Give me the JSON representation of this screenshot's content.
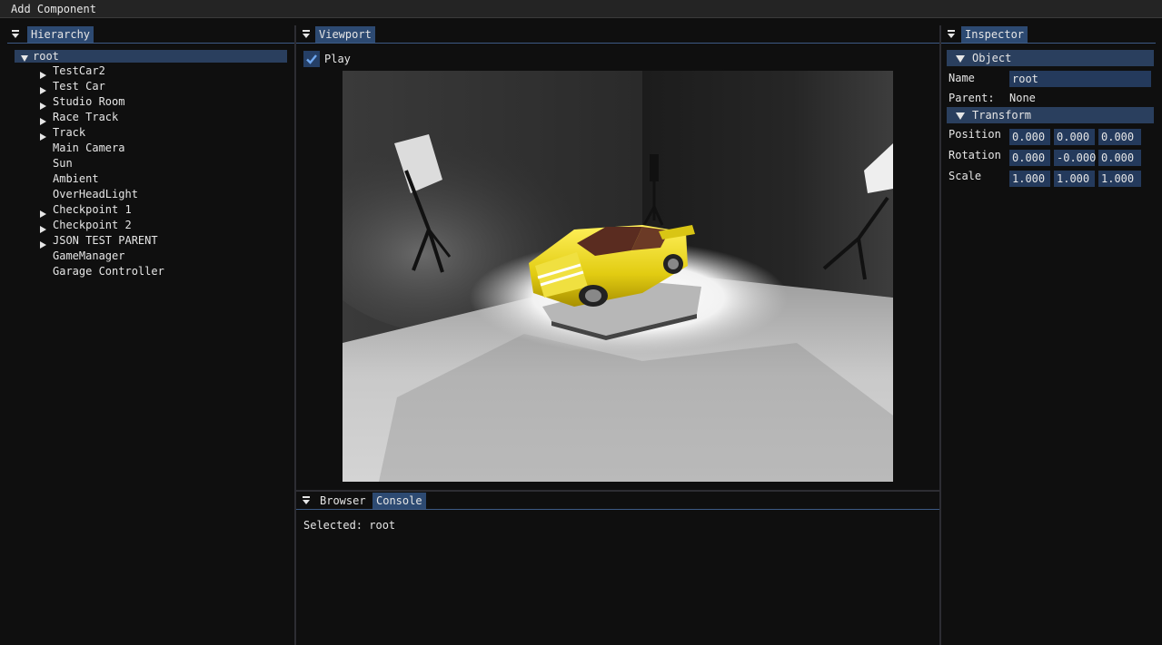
{
  "menubar": {
    "add_component": "Add Component"
  },
  "hierarchy": {
    "tab_label": "Hierarchy",
    "root_label": "root",
    "items": [
      {
        "label": "TestCar2",
        "expandable": true
      },
      {
        "label": "Test Car",
        "expandable": true
      },
      {
        "label": "Studio Room",
        "expandable": true
      },
      {
        "label": "Race Track",
        "expandable": true
      },
      {
        "label": "Track",
        "expandable": true
      },
      {
        "label": "Main Camera",
        "expandable": false
      },
      {
        "label": "Sun",
        "expandable": false
      },
      {
        "label": "Ambient",
        "expandable": false
      },
      {
        "label": "OverHeadLight",
        "expandable": false
      },
      {
        "label": "Checkpoint 1",
        "expandable": true
      },
      {
        "label": "Checkpoint 2",
        "expandable": true
      },
      {
        "label": "JSON TEST PARENT",
        "expandable": true
      },
      {
        "label": "GameManager",
        "expandable": false
      },
      {
        "label": "Garage Controller",
        "expandable": false
      }
    ]
  },
  "viewport": {
    "tab_label": "Viewport",
    "play_label": "Play",
    "play_checked": true
  },
  "bottom": {
    "tabs": [
      {
        "label": "Browser",
        "active": false
      },
      {
        "label": "Console",
        "active": true
      }
    ],
    "console_line": "Selected: root"
  },
  "inspector": {
    "tab_label": "Inspector",
    "object_header": "Object",
    "name_label": "Name",
    "name_value": "root",
    "parent_label": "Parent:",
    "parent_value": "None",
    "transform_header": "Transform",
    "position": {
      "label": "Position",
      "values": [
        "0.000",
        "0.000",
        "0.000"
      ]
    },
    "rotation": {
      "label": "Rotation",
      "values": [
        "0.000",
        "-0.000",
        "0.000"
      ]
    },
    "scale": {
      "label": "Scale",
      "values": [
        "1.000",
        "1.000",
        "1.000"
      ]
    }
  },
  "colors": {
    "accent": "#2d4a72",
    "field_bg": "#243a5c",
    "header_bg": "#2a3f5e",
    "car": "#e6d21a"
  }
}
